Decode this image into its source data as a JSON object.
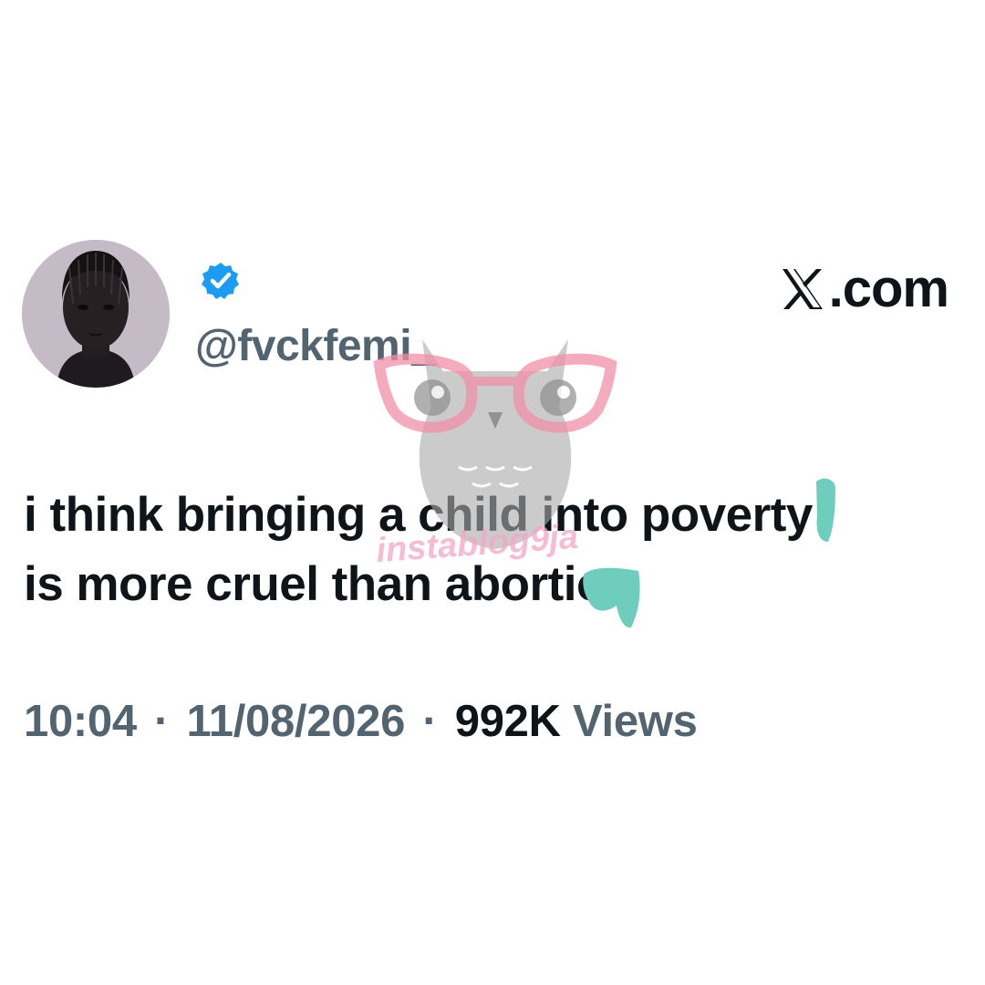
{
  "post": {
    "handle": "@fvckfemi_",
    "verified_icon": "verified-badge-icon",
    "verified_color": "#1d9bf0",
    "site": ".com",
    "text_lines": [
      "i think bringing a child into poverty",
      "is more cruel than abortion"
    ],
    "time": "10:04",
    "date": "11/08/2026",
    "view_count": "992K",
    "views_label": "Views",
    "separator": "·"
  },
  "watermark": {
    "text": "instablog9ja",
    "logo_icon": "owl-glasses-logo",
    "text_color": "#f4a7c3",
    "owl_color": "#a9a9a9",
    "glasses_color": "#f08fa8"
  },
  "colors": {
    "text_primary": "#0f1419",
    "text_secondary": "#536471",
    "background": "#ffffff",
    "censor_mark": "#6ecdbd"
  }
}
